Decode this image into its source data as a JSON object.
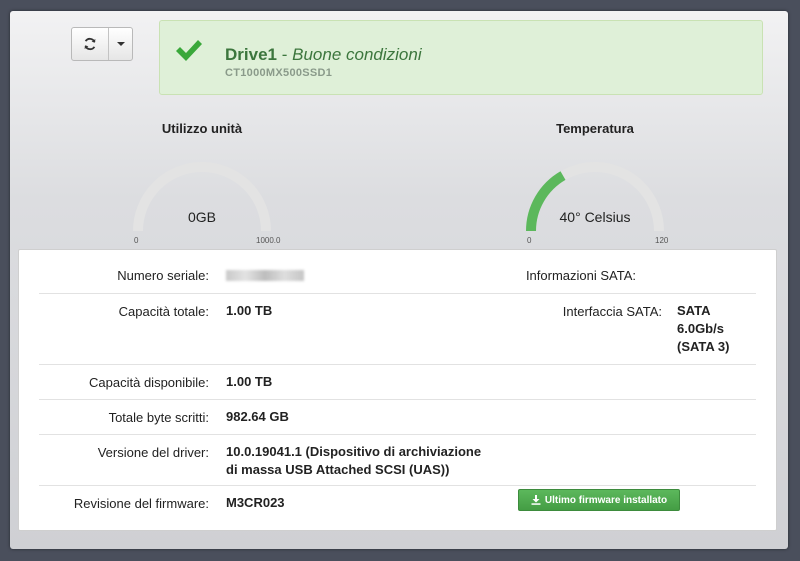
{
  "toolbar": {
    "refresh_icon": "refresh-icon",
    "dropdown_icon": "caret-down-icon"
  },
  "status": {
    "drive_name": "Drive1",
    "separator": "-",
    "condition": "Buone condizioni",
    "model": "CT1000MX500SSD1",
    "color": "#3c763d"
  },
  "usage_gauge": {
    "title": "Utilizzo unità",
    "value_label": "0GB",
    "min": "0",
    "max": "1000.0",
    "fill_fraction": 0.0
  },
  "temp_gauge": {
    "title": "Temperatura",
    "value_label": "40° Celsius",
    "min": "0",
    "max": "120",
    "fill_fraction": 0.3333,
    "fill_color": "#5cb85c"
  },
  "details": {
    "serial_label": "Numero seriale:",
    "sata_info_label": "Informazioni SATA:",
    "capacity_label": "Capacità totale:",
    "capacity_value": "1.00 TB",
    "sata_iface_label": "Interfaccia SATA:",
    "sata_iface_line1": "SATA",
    "sata_iface_line2": "6.0Gb/s",
    "sata_iface_line3": "(SATA 3)",
    "available_label": "Capacità disponibile:",
    "available_value": "1.00 TB",
    "written_label": "Totale byte scritti:",
    "written_value": "982.64 GB",
    "driver_label": "Versione del driver:",
    "driver_line1": "10.0.19041.1 (Dispositivo di archiviazione",
    "driver_line2": "di massa USB Attached SCSI (UAS))",
    "firmware_label": "Revisione del firmware:",
    "firmware_value": "M3CR023",
    "firmware_button": "Ultimo firmware installato"
  }
}
